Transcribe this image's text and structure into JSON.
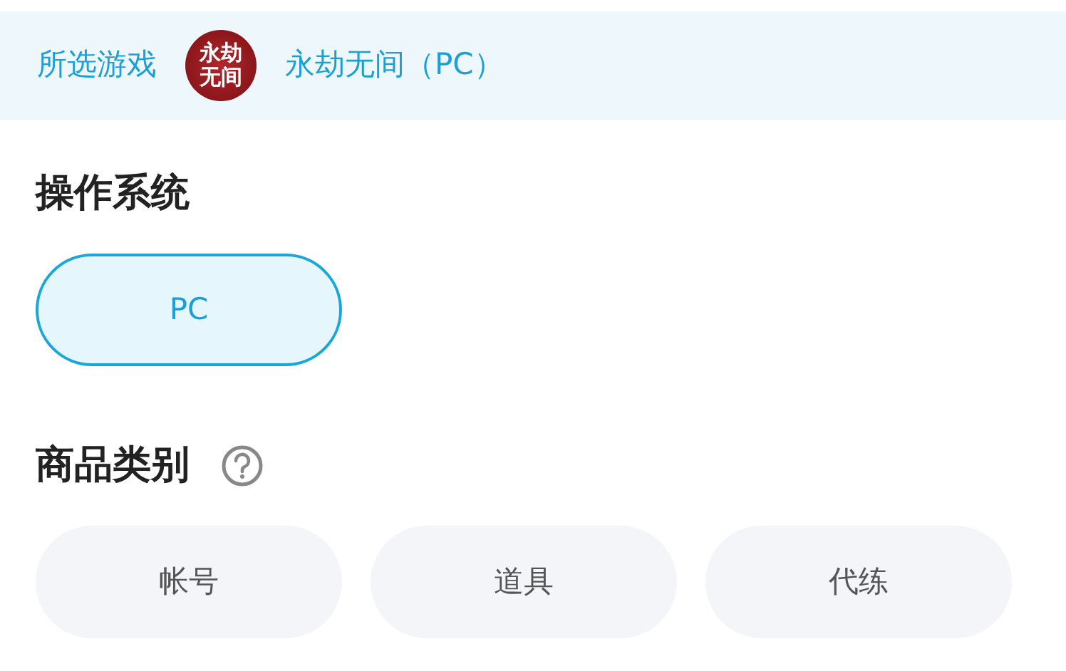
{
  "selected_game": {
    "label": "所选游戏",
    "logo_lines": [
      "永劫",
      "无间"
    ],
    "name": "永劫无间（PC）"
  },
  "sections": [
    {
      "title": "操作系统",
      "help": false,
      "options": [
        {
          "label": "PC",
          "selected": true
        }
      ]
    },
    {
      "title": "商品类别",
      "help": true,
      "options": [
        {
          "label": "帐号",
          "selected": false
        },
        {
          "label": "道具",
          "selected": false
        },
        {
          "label": "代练",
          "selected": false
        }
      ]
    }
  ]
}
